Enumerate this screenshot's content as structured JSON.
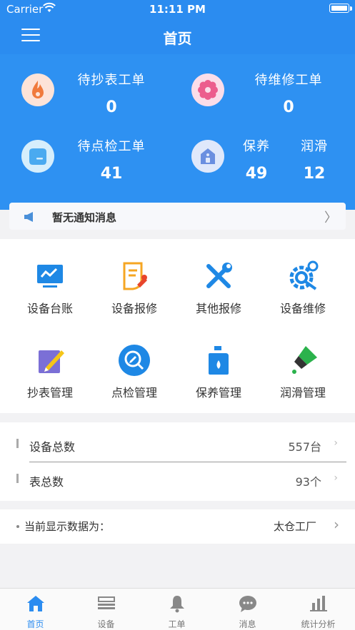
{
  "status_bar": {
    "carrier": "Carrier",
    "time": "11:11 PM"
  },
  "nav": {
    "title": "首页"
  },
  "stats": [
    {
      "label": "待抄表工单",
      "value": "0",
      "icon": "flame-icon"
    },
    {
      "label": "待维修工单",
      "value": "0",
      "icon": "gear-flower-icon"
    },
    {
      "label": "待点检工单",
      "value": "41",
      "icon": "checklist-box-icon"
    },
    {
      "label": "保养",
      "value": "49",
      "icon": "house-icon"
    },
    {
      "label": "润滑",
      "value": "12"
    }
  ],
  "notice": {
    "text": "暂无通知消息",
    "chevron": "〉"
  },
  "grid": [
    {
      "label": "设备台账",
      "icon": "monitor-chart-icon"
    },
    {
      "label": "设备报修",
      "icon": "document-wrench-icon"
    },
    {
      "label": "其他报修",
      "icon": "crossed-tools-icon"
    },
    {
      "label": "设备维修",
      "icon": "gear-wrench-icon"
    },
    {
      "label": "抄表管理",
      "icon": "pencil-note-icon"
    },
    {
      "label": "点检管理",
      "icon": "magnifier-edit-icon"
    },
    {
      "label": "保养管理",
      "icon": "oil-bottle-icon"
    },
    {
      "label": "润滑管理",
      "icon": "lubricant-dropper-icon"
    }
  ],
  "totals": [
    {
      "label": "设备总数",
      "value": "557台",
      "chevron": "›"
    },
    {
      "label": "表总数",
      "value": "93个",
      "chevron": "›"
    }
  ],
  "factory": {
    "label": "当前显示数据为：",
    "value": "太仓工厂",
    "chevron": "›"
  },
  "tabs": [
    {
      "label": "首页",
      "icon": "home-icon",
      "active": true
    },
    {
      "label": "设备",
      "icon": "device-icon"
    },
    {
      "label": "工单",
      "icon": "bell-icon"
    },
    {
      "label": "消息",
      "icon": "chat-bubble-icon"
    },
    {
      "label": "统计分析",
      "icon": "bar-chart-icon"
    }
  ],
  "colors": {
    "primary": "#2b8cf0",
    "hero": "#2e91f2",
    "flame_bg": "#fde3d8",
    "flame": "#f07a3c",
    "gear_bg": "#fbdde9",
    "gear": "#ec5d8d",
    "check_bg": "#d6eefc",
    "check": "#4aaaf0",
    "house_bg": "#dfe8fb",
    "house": "#6a8fe0"
  }
}
